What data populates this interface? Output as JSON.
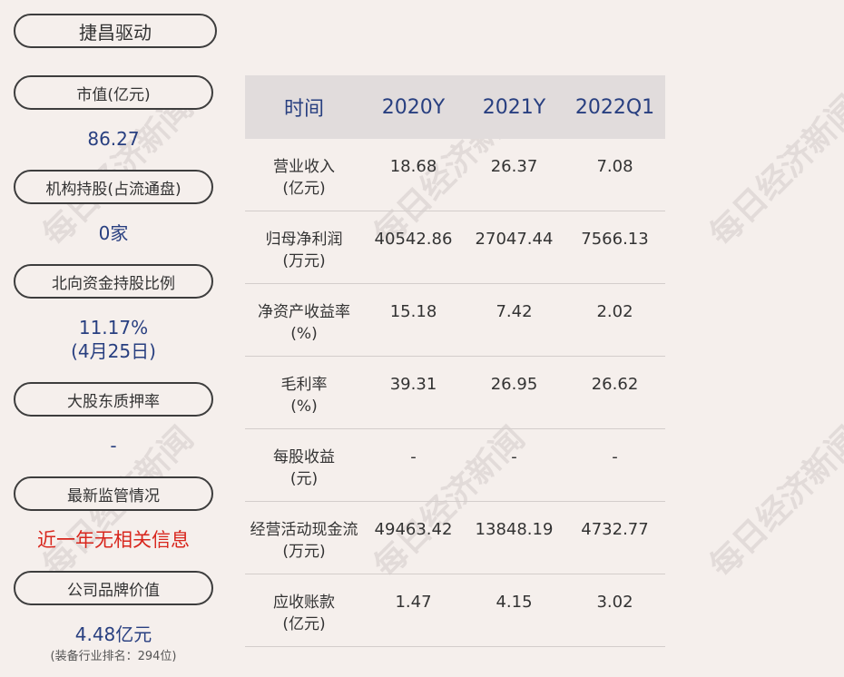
{
  "company": "捷昌驱动",
  "watermark": "每日经济新闻",
  "sidebar": [
    {
      "label": "市值(亿元)",
      "value": "86.27"
    },
    {
      "label": "机构持股(占流通盘)",
      "value": "0家"
    },
    {
      "label": "北向资金持股比例",
      "value": "11.17%",
      "value2": "(4月25日)"
    },
    {
      "label": "大股东质押率",
      "value": "-"
    },
    {
      "label": "最新监管情况",
      "value": "近一年无相关信息"
    },
    {
      "label": "公司品牌价值",
      "value": "4.48亿元",
      "note": "(装备行业排名：294位)"
    }
  ],
  "table": {
    "headers": [
      "时间",
      "2020Y",
      "2021Y",
      "2022Q1"
    ],
    "rows": [
      {
        "label": "营业收入",
        "unit": "(亿元)",
        "values": [
          "18.68",
          "26.37",
          "7.08"
        ]
      },
      {
        "label": "归母净利润",
        "unit": "(万元)",
        "values": [
          "40542.86",
          "27047.44",
          "7566.13"
        ]
      },
      {
        "label": "净资产收益率",
        "unit": "(%)",
        "values": [
          "15.18",
          "7.42",
          "2.02"
        ]
      },
      {
        "label": "毛利率",
        "unit": "(%)",
        "values": [
          "39.31",
          "26.95",
          "26.62"
        ]
      },
      {
        "label": "每股收益",
        "unit": "(元)",
        "values": [
          "-",
          "-",
          "-"
        ]
      },
      {
        "label": "经营活动现金流",
        "unit": "(万元)",
        "values": [
          "49463.42",
          "13848.19",
          "4732.77"
        ]
      },
      {
        "label": "应收账款",
        "unit": "(亿元)",
        "values": [
          "1.47",
          "4.15",
          "3.02"
        ]
      }
    ]
  },
  "colors": {
    "value_blue": "#283f80",
    "alert_red": "#d8261d",
    "background": "#f5efec",
    "header_bg": "#e1dcdc"
  }
}
